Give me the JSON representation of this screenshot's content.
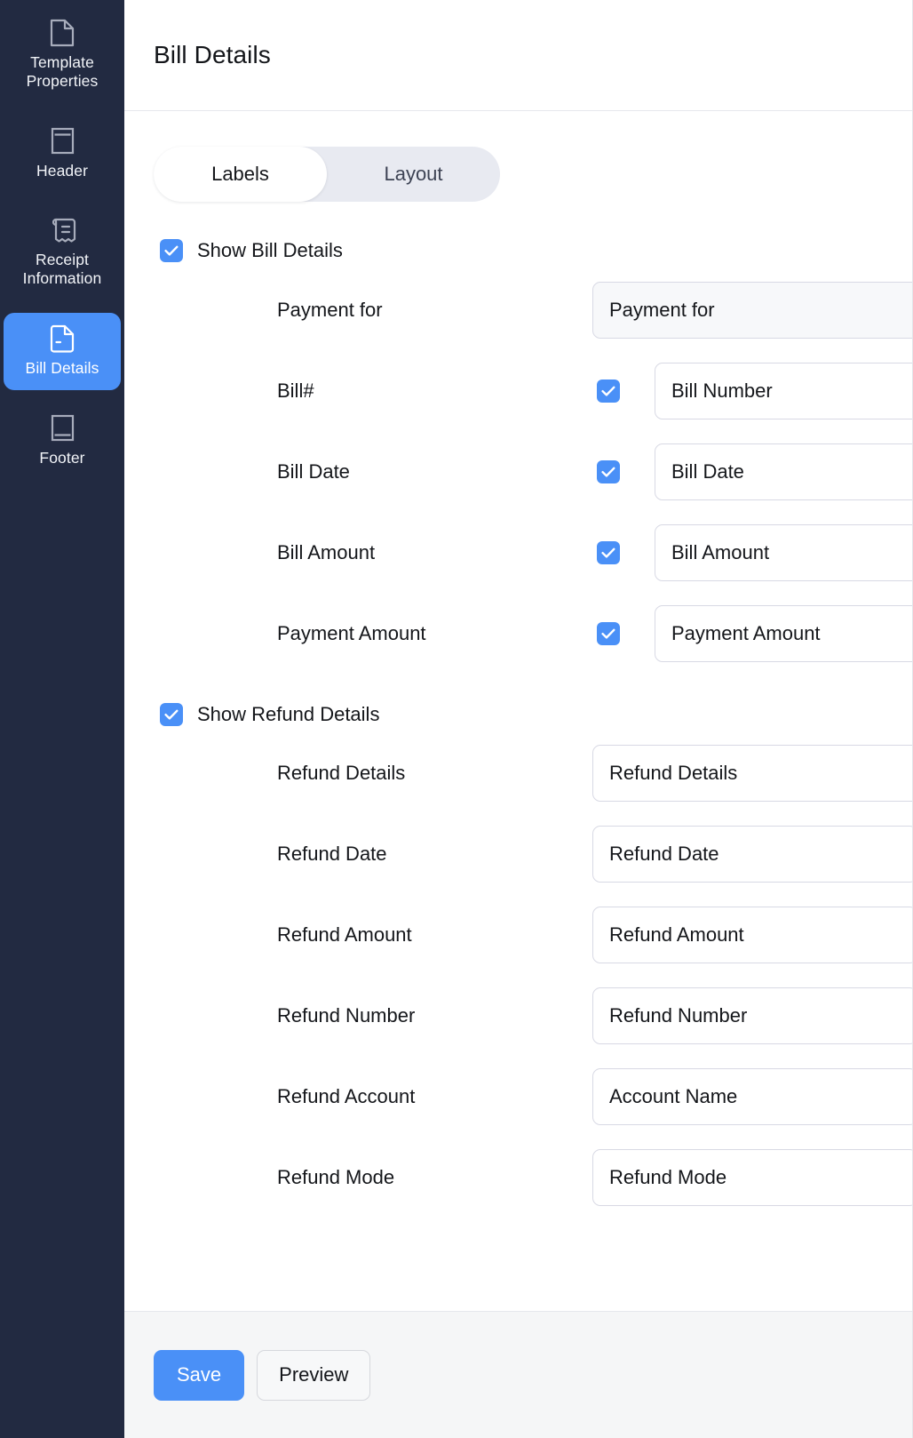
{
  "sidebar": {
    "items": [
      {
        "label": "Template Properties",
        "icon": "document-icon",
        "active": false
      },
      {
        "label": "Header",
        "icon": "header-block-icon",
        "active": false
      },
      {
        "label": "Receipt Information",
        "icon": "receipt-icon",
        "active": false
      },
      {
        "label": "Bill Details",
        "icon": "bill-document-icon",
        "active": true
      },
      {
        "label": "Footer",
        "icon": "footer-block-icon",
        "active": false
      }
    ]
  },
  "header": {
    "title": "Bill Details"
  },
  "tabs": {
    "items": [
      {
        "label": "Labels",
        "active": true
      },
      {
        "label": "Layout",
        "active": false
      }
    ]
  },
  "bill_section": {
    "toggle_label": "Show Bill Details",
    "toggle_checked": true,
    "rows": [
      {
        "label": "Payment for",
        "value": "Payment for",
        "has_checkbox": false,
        "checked": false,
        "muted": true
      },
      {
        "label": "Bill#",
        "value": "Bill Number",
        "has_checkbox": true,
        "checked": true,
        "muted": false
      },
      {
        "label": "Bill Date",
        "value": "Bill Date",
        "has_checkbox": true,
        "checked": true,
        "muted": false
      },
      {
        "label": "Bill Amount",
        "value": "Bill Amount",
        "has_checkbox": true,
        "checked": true,
        "muted": false
      },
      {
        "label": "Payment Amount",
        "value": "Payment Amount",
        "has_checkbox": true,
        "checked": true,
        "muted": false
      }
    ]
  },
  "refund_section": {
    "toggle_label": "Show Refund Details",
    "toggle_checked": true,
    "rows": [
      {
        "label": "Refund Details",
        "value": "Refund Details",
        "width": "wide"
      },
      {
        "label": "Refund Date",
        "value": "Refund Date",
        "width": "narrow"
      },
      {
        "label": "Refund Amount",
        "value": "Refund Amount",
        "width": "narrow"
      },
      {
        "label": "Refund Number",
        "value": "Refund Number",
        "width": "narrow"
      },
      {
        "label": "Refund Account",
        "value": "Account Name",
        "width": "narrow"
      },
      {
        "label": "Refund Mode",
        "value": "Refund Mode",
        "width": "narrow"
      }
    ]
  },
  "footer": {
    "save_label": "Save",
    "preview_label": "Preview"
  },
  "colors": {
    "accent": "#4a90f7",
    "sidebar_bg": "#222a41",
    "footer_bg": "#f5f6f7",
    "field_border": "#d8d9e4",
    "muted_field_bg": "#f7f8fa",
    "segmented_bg": "#e8eaf1"
  }
}
